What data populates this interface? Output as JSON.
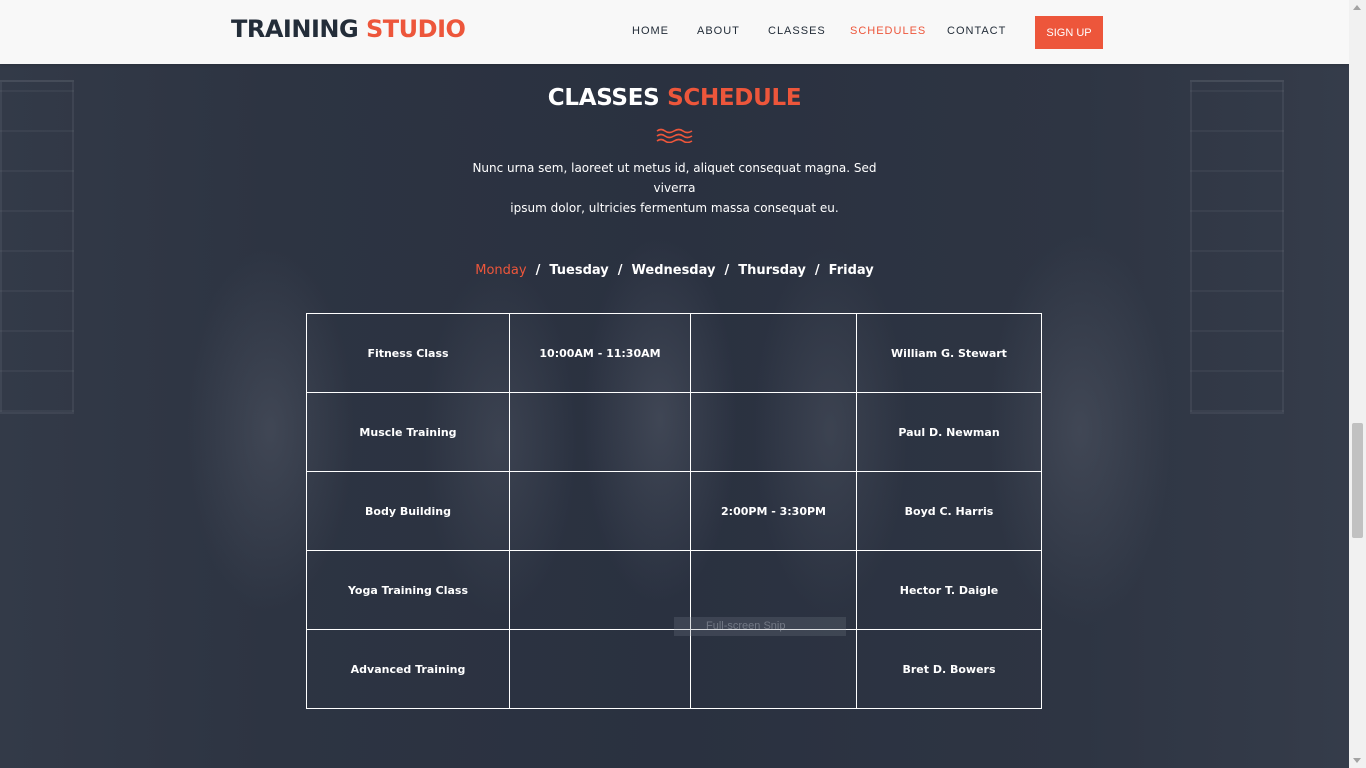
{
  "header": {
    "logo_main": "TRAINING",
    "logo_accent": "STUDIO",
    "nav": [
      {
        "label": "HOME",
        "active": false
      },
      {
        "label": "ABOUT",
        "active": false
      },
      {
        "label": "CLASSES",
        "active": false
      },
      {
        "label": "SCHEDULES",
        "active": true
      },
      {
        "label": "CONTACT",
        "active": false
      }
    ],
    "signup_label": "SIGN UP"
  },
  "section": {
    "title_main": "CLASSES",
    "title_accent": "SCHEDULE",
    "intro_line1": "Nunc urna sem, laoreet ut metus id, aliquet consequat magna. Sed viverra",
    "intro_line2": "ipsum dolor, ultricies fermentum massa consequat eu."
  },
  "tabs": [
    {
      "label": "Monday",
      "active": true
    },
    {
      "label": "Tuesday",
      "active": false
    },
    {
      "label": "Wednesday",
      "active": false
    },
    {
      "label": "Thursday",
      "active": false
    },
    {
      "label": "Friday",
      "active": false
    }
  ],
  "tab_separator": "/",
  "schedule": {
    "rows": [
      {
        "class": "Fitness Class",
        "time1": "10:00AM - 11:30AM",
        "time2": "",
        "trainer": "William G. Stewart"
      },
      {
        "class": "Muscle Training",
        "time1": "",
        "time2": "",
        "trainer": "Paul D. Newman"
      },
      {
        "class": "Body Building",
        "time1": "",
        "time2": "2:00PM - 3:30PM",
        "trainer": "Boyd C. Harris"
      },
      {
        "class": "Yoga Training Class",
        "time1": "",
        "time2": "",
        "trainer": "Hector T. Daigle"
      },
      {
        "class": "Advanced Training",
        "time1": "",
        "time2": "",
        "trainer": "Bret D. Bowers"
      }
    ]
  },
  "overlay_label": "Full-screen Snip",
  "colors": {
    "accent": "#ed563b",
    "dark": "#232d39",
    "header_bg": "#f8f8f8"
  },
  "icons": {
    "divider": "waves-icon"
  }
}
